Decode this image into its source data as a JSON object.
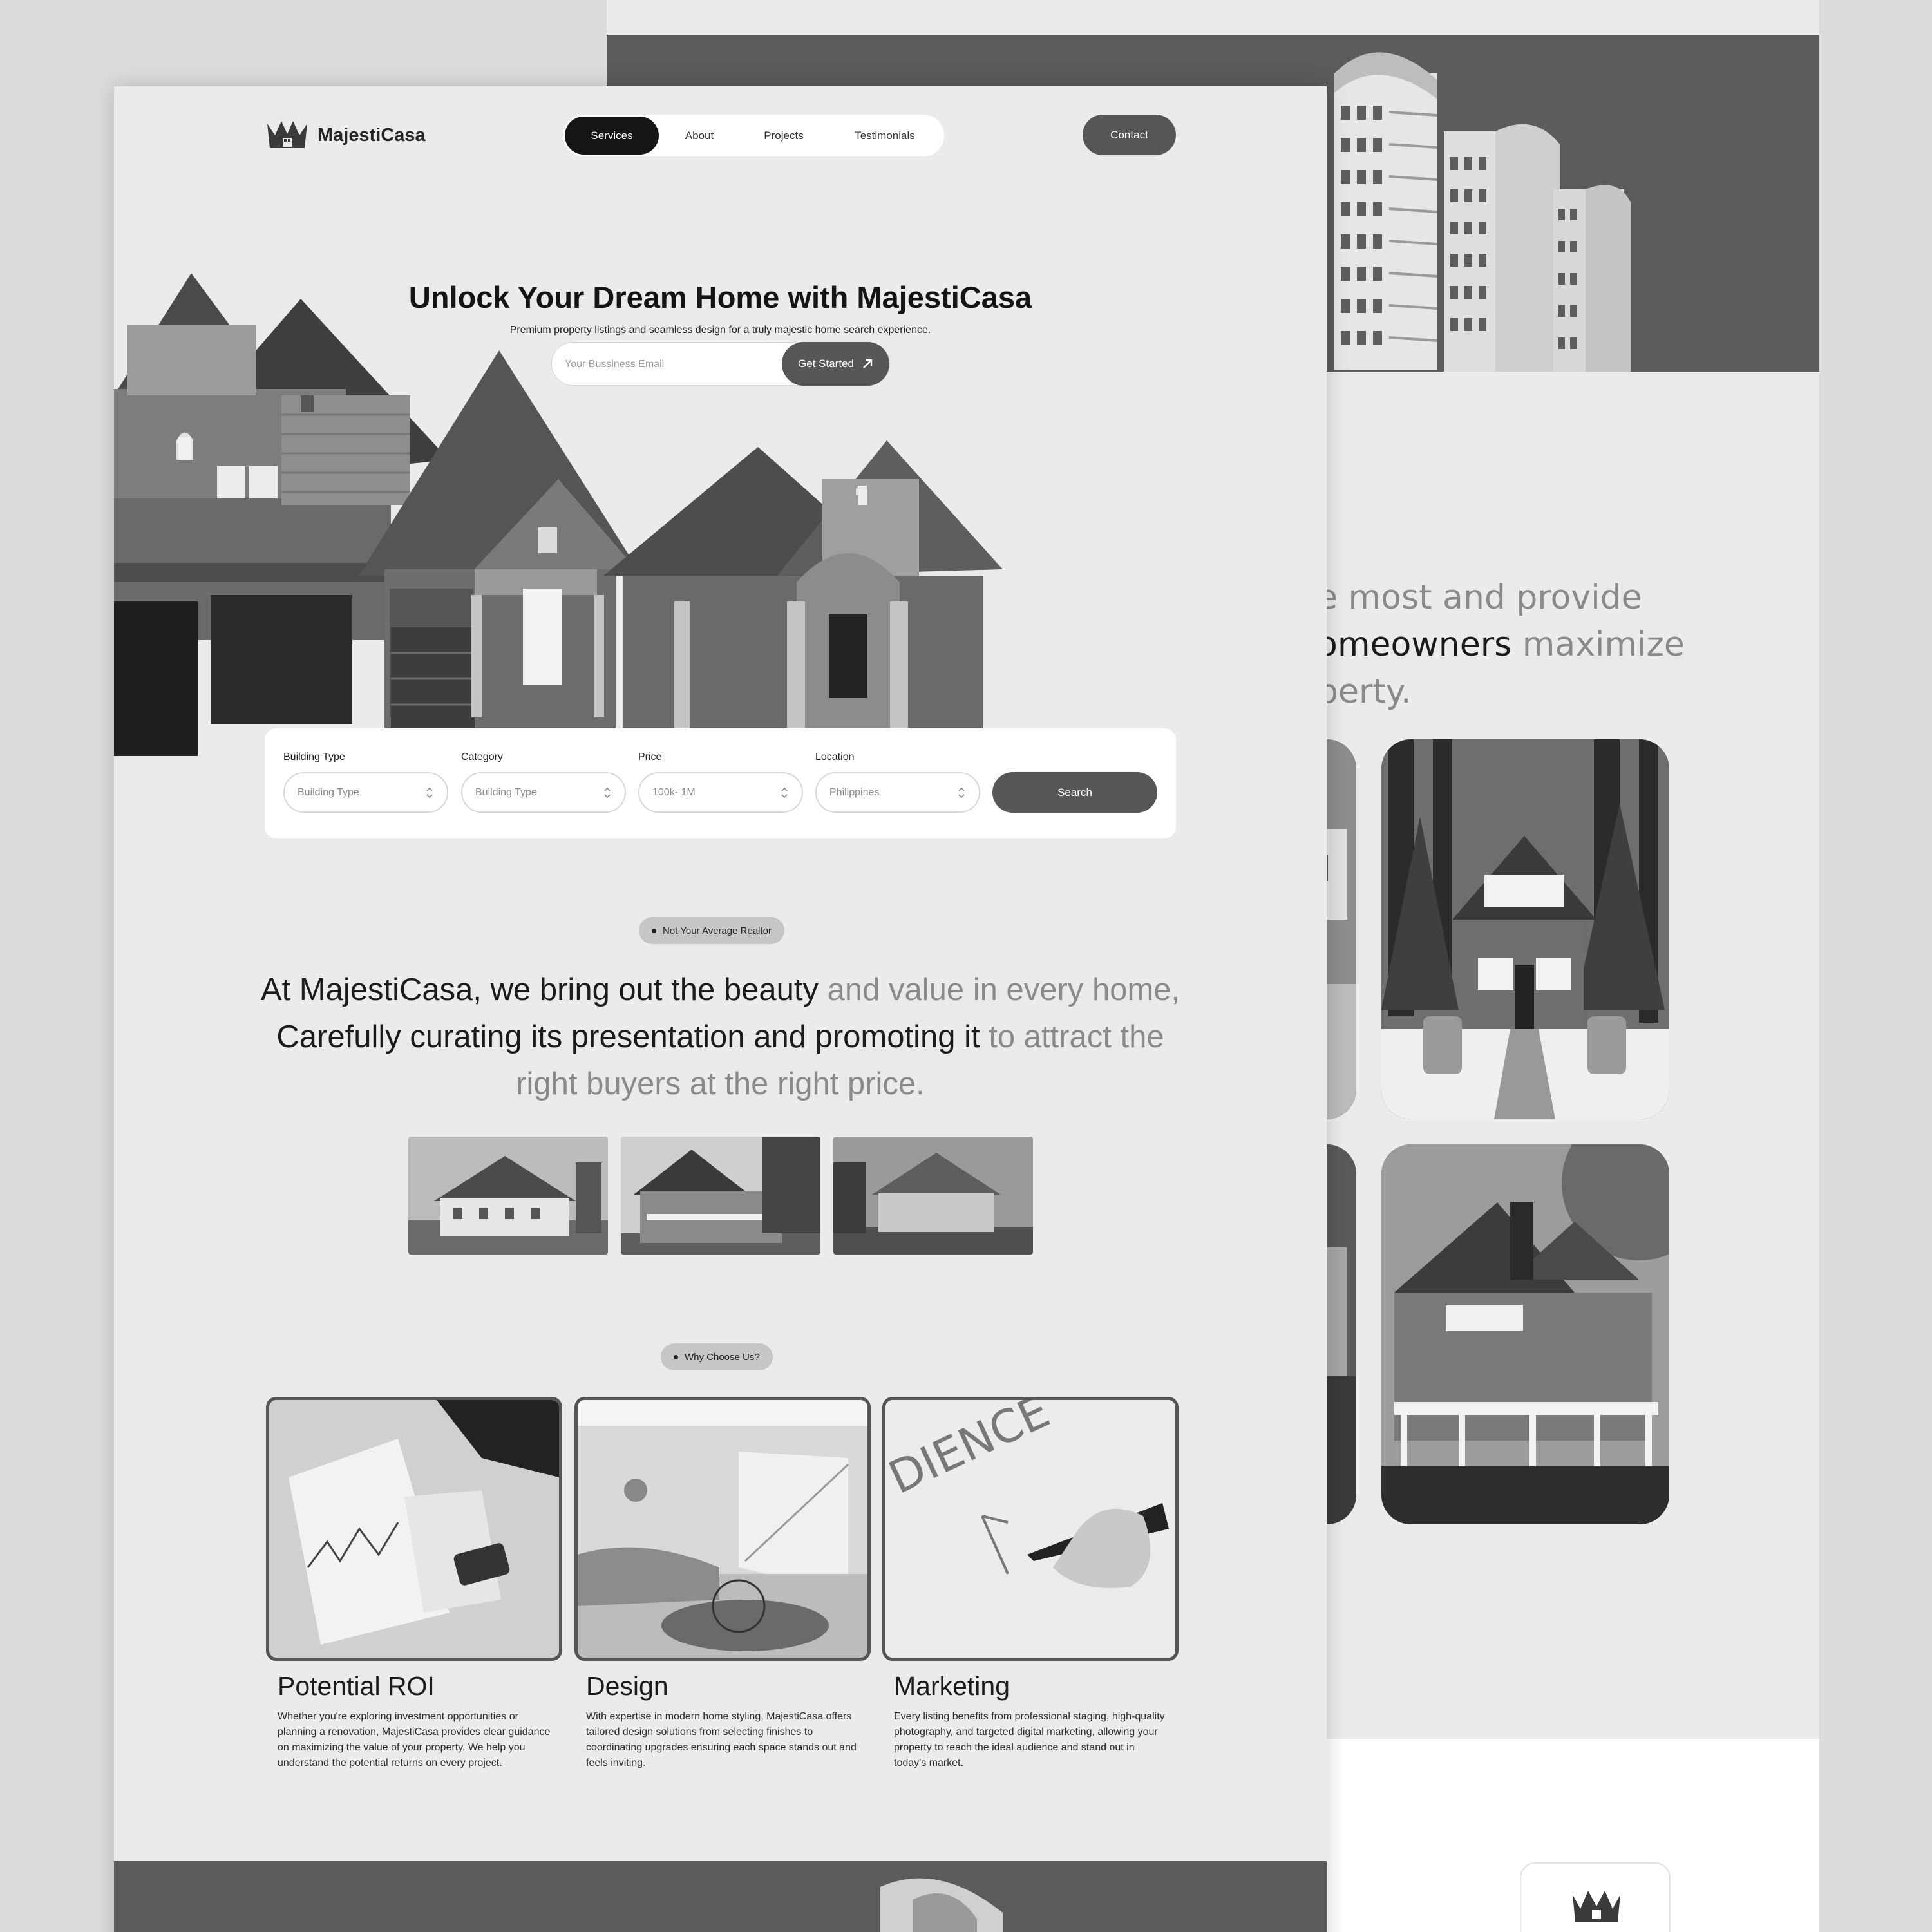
{
  "brand": {
    "name": "MajestiCasa"
  },
  "nav": {
    "items": [
      {
        "label": "Services",
        "active": true
      },
      {
        "label": "About",
        "active": false
      },
      {
        "label": "Projects",
        "active": false
      },
      {
        "label": "Testimonials",
        "active": false
      }
    ],
    "contact_label": "Contact"
  },
  "hero": {
    "title": "Unlock Your Dream Home with MajestiCasa",
    "subtitle": "Premium property listings and seamless design for a truly majestic home search experience.",
    "email_placeholder": "Your Bussiness Email",
    "cta_label": "Get Started"
  },
  "search": {
    "fields": [
      {
        "label": "Building Type",
        "value": "Building Type"
      },
      {
        "label": "Category",
        "value": "Building Type"
      },
      {
        "label": "Price",
        "value": "100k- 1M"
      },
      {
        "label": "Location",
        "value": "Philippines"
      }
    ],
    "button_label": "Search"
  },
  "about": {
    "tag": "Not Your Average Realtor",
    "text_1": "At MajestiCasa, we bring out the beauty",
    "text_2": " and value in every home,",
    "text_3": " Carefully curating its presentation and promoting it",
    "text_4": " to attract the right buyers at the right price."
  },
  "why": {
    "tag": "Why Choose Us?",
    "cards": [
      {
        "title": "Potential ROI",
        "description": "Whether you're exploring investment opportunities or planning a renovation, MajestiCasa provides clear guidance on maximizing the value of your property. We help you understand the potential returns on every project."
      },
      {
        "title": "Design",
        "description": "With expertise in modern home styling, MajestiCasa offers tailored design solutions from selecting finishes to coordinating upgrades ensuring each space stands out and feels inviting."
      },
      {
        "title": "Marketing",
        "description": "Every listing benefits from professional staging, high-quality photography, and targeted digital marketing, allowing your property to reach the ideal audience and stand out in today's market."
      }
    ]
  },
  "back_page": {
    "line_1": "e most and provide",
    "line_2a": "omeowners",
    "line_2b": " maximize",
    "line_3": "perty."
  },
  "colors": {
    "accent_dark": "#565656",
    "nav_active": "#151515",
    "page_bg": "#ebebeb",
    "muted_text": "#8a8a8a"
  }
}
